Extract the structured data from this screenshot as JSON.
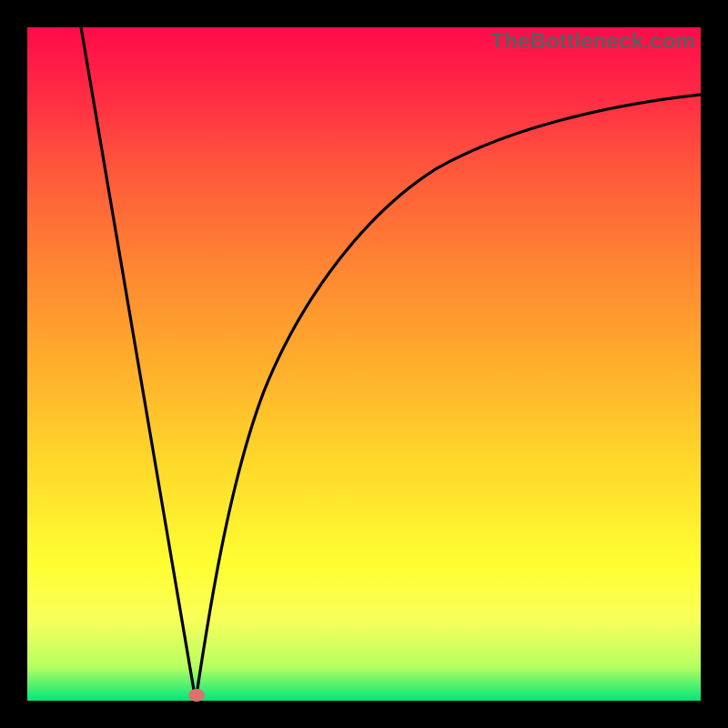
{
  "watermark": "TheBottleneck.com",
  "colors": {
    "frame": "#000000",
    "gradient_top": "#ff0a4a",
    "gradient_bottom": "#00e67a",
    "curve": "#000000",
    "marker": "#d9736f"
  },
  "chart_data": {
    "type": "line",
    "title": "",
    "xlabel": "",
    "ylabel": "",
    "xlim": [
      0,
      100
    ],
    "ylim": [
      0,
      100
    ],
    "series": [
      {
        "name": "left-branch",
        "x": [
          8,
          12,
          16,
          20,
          23,
          25
        ],
        "y": [
          100,
          76,
          52,
          28,
          10,
          0
        ]
      },
      {
        "name": "right-branch",
        "x": [
          25,
          27,
          30,
          35,
          40,
          50,
          60,
          70,
          80,
          90,
          100
        ],
        "y": [
          0,
          14,
          30,
          48,
          59,
          72,
          79,
          83,
          86,
          88,
          90
        ]
      }
    ],
    "marker": {
      "x": 25,
      "y": 0
    }
  }
}
